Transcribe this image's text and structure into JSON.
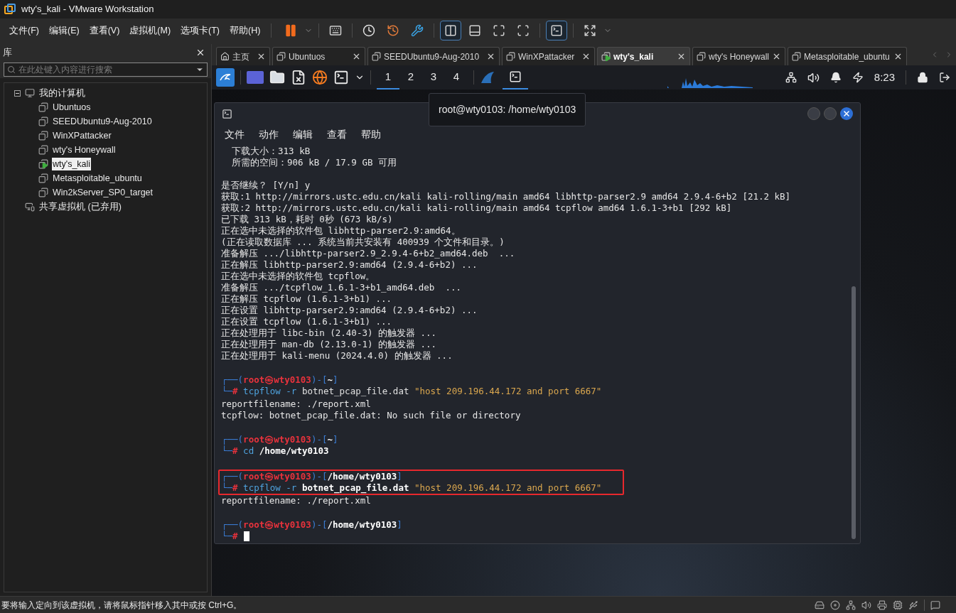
{
  "window": {
    "title": "wty's_kali - VMware Workstation"
  },
  "menu": [
    "文件(F)",
    "编辑(E)",
    "查看(V)",
    "虚拟机(M)",
    "选项卡(T)",
    "帮助(H)"
  ],
  "toolbar": [
    {
      "kind": "pause",
      "selected": false
    },
    {
      "kind": "send-keys",
      "selected": false
    },
    {
      "kind": "snapshot",
      "selected": false
    },
    {
      "kind": "revert",
      "selected": false
    },
    {
      "kind": "manager",
      "selected": false
    },
    {
      "kind": "library",
      "selected": true
    },
    {
      "kind": "thumbs",
      "selected": false
    },
    {
      "kind": "fullscreen",
      "selected": false
    },
    {
      "kind": "unity",
      "selected": false
    },
    {
      "kind": "console",
      "selected": true
    },
    {
      "kind": "stretch",
      "selected": false
    }
  ],
  "library": {
    "title": "库",
    "search": {
      "placeholder": "在此处键入内容进行搜索"
    },
    "tree": [
      {
        "label": "我的计算机",
        "kind": "computer",
        "expanded": true,
        "children": [
          {
            "label": "Ubuntuos",
            "selected": false,
            "running": false
          },
          {
            "label": "SEEDUbuntu9-Aug-2010",
            "selected": false,
            "running": false
          },
          {
            "label": "WinXPattacker",
            "selected": false,
            "running": false
          },
          {
            "label": "wty's Honeywall",
            "selected": false,
            "running": false
          },
          {
            "label": "wty's_kali",
            "selected": true,
            "running": true
          },
          {
            "label": "Metasploitable_ubuntu",
            "selected": false,
            "running": false
          },
          {
            "label": "Win2kServer_SP0_target",
            "selected": false,
            "running": false
          }
        ]
      },
      {
        "label": "共享虚拟机 (已弃用)",
        "kind": "shared"
      }
    ]
  },
  "tabs": [
    {
      "label": "主页",
      "kind": "home",
      "selected": false
    },
    {
      "label": "Ubuntuos",
      "kind": "vm",
      "selected": false,
      "running": false
    },
    {
      "label": "SEEDUbuntu9-Aug-2010",
      "kind": "vm",
      "selected": false,
      "running": false
    },
    {
      "label": "WinXPattacker",
      "kind": "vm",
      "selected": false,
      "running": false
    },
    {
      "label": "wty's_kali",
      "kind": "vm",
      "selected": true,
      "running": true
    },
    {
      "label": "wty's Honeywall",
      "kind": "vm",
      "selected": false,
      "running": false
    },
    {
      "label": "Metasploitable_ubuntu",
      "kind": "vm",
      "selected": false,
      "running": false
    }
  ],
  "kali_panel": {
    "workspaces": [
      {
        "label": "1",
        "selected": true
      },
      {
        "label": "2",
        "selected": false
      },
      {
        "label": "3",
        "selected": false
      },
      {
        "label": "4",
        "selected": false
      }
    ],
    "clock": "8:23"
  },
  "tooltip": "root@wty0103: /home/wty0103",
  "terminal": {
    "menu": [
      "文件",
      "动作",
      "编辑",
      "查看",
      "帮助"
    ],
    "blocks": [
      {
        "kind": "output",
        "lines": [
          "  下载大小：313 kB",
          "  所需的空间：906 kB / 17.9 GB 可用"
        ]
      },
      {
        "kind": "output",
        "lines": [
          "是否继续？ [Y/n] y",
          "获取:1 http://mirrors.ustc.edu.cn/kali kali-rolling/main amd64 libhttp-parser2.9 amd64 2.9.4-6+b2 [21.2 kB]",
          "获取:2 http://mirrors.ustc.edu.cn/kali kali-rolling/main amd64 tcpflow amd64 1.6.1-3+b1 [292 kB]",
          "已下载 313 kB，耗时 0秒 (673 kB/s)",
          "正在选中未选择的软件包 libhttp-parser2.9:amd64。",
          "(正在读取数据库 ... 系统当前共安装有 400939 个文件和目录。)",
          "准备解压 .../libhttp-parser2.9_2.9.4-6+b2_amd64.deb  ...",
          "正在解压 libhttp-parser2.9:amd64 (2.9.4-6+b2) ...",
          "正在选中未选择的软件包 tcpflow。",
          "准备解压 .../tcpflow_1.6.1-3+b1_amd64.deb  ...",
          "正在解压 tcpflow (1.6.1-3+b1) ...",
          "正在设置 libhttp-parser2.9:amd64 (2.9.4-6+b2) ...",
          "正在设置 tcpflow (1.6.1-3+b1) ...",
          "正在处理用于 libc-bin (2.40-3) 的触发器 ...",
          "正在处理用于 man-db (2.13.0-1) 的触发器 ...",
          "正在处理用于 kali-menu (2024.4.0) 的触发器 ..."
        ]
      },
      {
        "kind": "prompt",
        "highlighted": false,
        "head": [
          {
            "text": "┌──(",
            "kind": "frame"
          },
          {
            "text": "root㉿wty0103",
            "kind": "user"
          },
          {
            "text": ")-[",
            "kind": "frame"
          },
          {
            "text": "~",
            "kind": "path"
          },
          {
            "text": "]",
            "kind": "frame"
          }
        ],
        "command": [
          {
            "text": "└─",
            "kind": "frame"
          },
          {
            "text": "#",
            "kind": "user"
          },
          {
            "text": " tcpflow -r",
            "kind": "cmd"
          },
          {
            "text": " botnet_pcap_file.dat",
            "kind": "arg"
          },
          {
            "text": " \"host 209.196.44.172 and port 6667\"",
            "kind": "string"
          }
        ],
        "output": [
          "reportfilename: ./report.xml",
          "tcpflow: botnet_pcap_file.dat: No such file or directory"
        ]
      },
      {
        "kind": "prompt",
        "highlighted": false,
        "head": [
          {
            "text": "┌──(",
            "kind": "frame"
          },
          {
            "text": "root㉿wty0103",
            "kind": "user"
          },
          {
            "text": ")-[",
            "kind": "frame"
          },
          {
            "text": "~",
            "kind": "path"
          },
          {
            "text": "]",
            "kind": "frame"
          }
        ],
        "command": [
          {
            "text": "└─",
            "kind": "frame"
          },
          {
            "text": "#",
            "kind": "user"
          },
          {
            "text": " cd",
            "kind": "cmd"
          },
          {
            "text": " /home/wty0103",
            "kind": "path"
          }
        ]
      },
      {
        "kind": "prompt",
        "highlighted": true,
        "head": [
          {
            "text": "┌──(",
            "kind": "frame"
          },
          {
            "text": "root㉿wty0103",
            "kind": "user"
          },
          {
            "text": ")-[",
            "kind": "frame"
          },
          {
            "text": "/home/wty0103",
            "kind": "path"
          },
          {
            "text": "]",
            "kind": "frame"
          }
        ],
        "command": [
          {
            "text": "└─",
            "kind": "frame"
          },
          {
            "text": "#",
            "kind": "user"
          },
          {
            "text": " tcpflow -r",
            "kind": "cmd"
          },
          {
            "text": " botnet_pcap_file.dat",
            "kind": "path"
          },
          {
            "text": " \"host 209.196.44.172 and port 6667\"",
            "kind": "string"
          }
        ],
        "output": [
          "reportfilename: ./report.xml"
        ]
      },
      {
        "kind": "prompt",
        "highlighted": false,
        "cursor": true,
        "head": [
          {
            "text": "┌──(",
            "kind": "frame"
          },
          {
            "text": "root㉿wty0103",
            "kind": "user"
          },
          {
            "text": ")-[",
            "kind": "frame"
          },
          {
            "text": "/home/wty0103",
            "kind": "path"
          },
          {
            "text": "]",
            "kind": "frame"
          }
        ],
        "command": [
          {
            "text": "└─",
            "kind": "frame"
          },
          {
            "text": "#",
            "kind": "user"
          }
        ]
      }
    ]
  },
  "status_bar": {
    "text": "要将输入定向到该虚拟机，请将鼠标指针移入其中或按 Ctrl+G。"
  }
}
